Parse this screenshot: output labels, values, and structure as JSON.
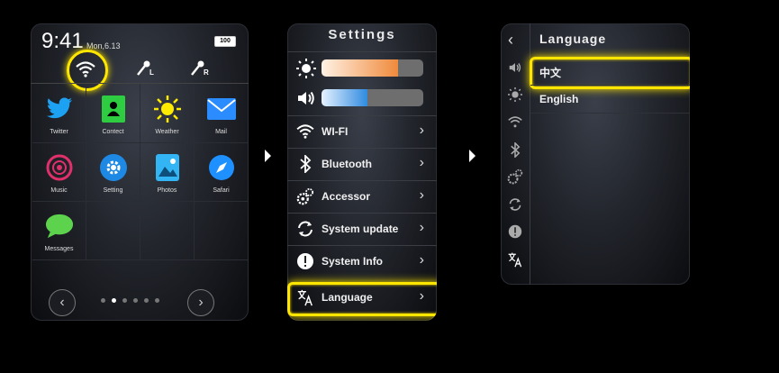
{
  "home": {
    "time": "9:41",
    "date": "Mon,6.13",
    "battery": "100",
    "apps": [
      {
        "label": "Twitter",
        "icon": "twitter-icon",
        "color": "#1da1f2"
      },
      {
        "label": "Contect",
        "icon": "contact-icon",
        "color": "#2ecc40"
      },
      {
        "label": "Weather",
        "icon": "sun-icon",
        "color": "#ffeb00"
      },
      {
        "label": "Mail",
        "icon": "mail-icon",
        "color": "#2b8cff"
      },
      {
        "label": "Music",
        "icon": "music-icon",
        "color": "#e0306a"
      },
      {
        "label": "Setting",
        "icon": "gear-icon",
        "color": "#1e88e5"
      },
      {
        "label": "Photos",
        "icon": "photos-icon",
        "color": "#33b5f5"
      },
      {
        "label": "Safari",
        "icon": "compass-icon",
        "color": "#1e90ff"
      },
      {
        "label": "Messages",
        "icon": "chat-icon",
        "color": "#5dd34d"
      }
    ],
    "top_icons": [
      "wifi-icon",
      "left-earbud-icon",
      "right-earbud-icon"
    ],
    "earbud_labels": {
      "left": "L",
      "right": "R"
    },
    "page_dots": 6,
    "active_dot": 1
  },
  "settings": {
    "title": "Settings",
    "brightness_level": 0.75,
    "volume_level": 0.45,
    "brightness_color": "#f08a3c",
    "volume_color": "#2f8be0",
    "items": [
      {
        "label": "WI-FI",
        "icon": "wifi-icon"
      },
      {
        "label": "Bluetooth",
        "icon": "bluetooth-icon"
      },
      {
        "label": "Accessor",
        "icon": "gears-icon"
      },
      {
        "label": "System update",
        "icon": "refresh-icon"
      },
      {
        "label": "System Info",
        "icon": "info-icon"
      },
      {
        "label": "Language",
        "icon": "translate-icon"
      }
    ]
  },
  "language": {
    "title": "Language",
    "options": [
      "中文",
      "English"
    ],
    "sidebar_icons": [
      "volume-icon",
      "brightness-icon",
      "wifi-icon",
      "bluetooth-icon",
      "gears-icon",
      "refresh-icon",
      "info-icon",
      "translate-icon"
    ]
  },
  "highlight_color": "#ffe600"
}
